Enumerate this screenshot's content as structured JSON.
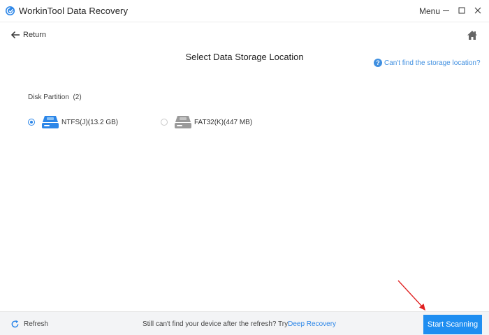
{
  "window": {
    "title": "WorkinTool Data Recovery",
    "menu_label": "Menu"
  },
  "nav": {
    "return_label": "Return"
  },
  "main": {
    "title": "Select Data Storage Location",
    "help_link": "Can't find the storage location?",
    "section_title": "Disk Partition  (2)",
    "partitions": [
      {
        "label": "NTFS(J)(13.2 GB)",
        "selected": true,
        "icon": "drive-icon",
        "color": "#2c86e8"
      },
      {
        "label": "FAT32(K)(447 MB)",
        "selected": false,
        "icon": "drive-icon",
        "color": "#9a9a9a"
      }
    ]
  },
  "footer": {
    "refresh_label": "Refresh",
    "message": "Still can't find your device after the refresh? Try",
    "deep_link": "Deep Recovery",
    "scan_button": "Start Scanning"
  },
  "colors": {
    "accent": "#2c86e8",
    "button": "#1f8ef1",
    "annotation": "#e02020"
  }
}
